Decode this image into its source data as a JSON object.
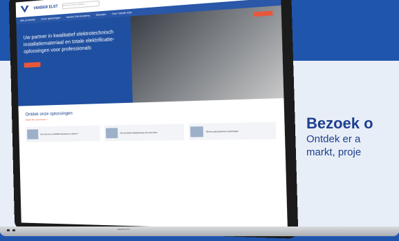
{
  "page": {
    "heading": "Bezoek o",
    "subtitle_line1": "Ontdek er a",
    "subtitle_line2": "markt, proje"
  },
  "laptop": {
    "base_label": "MacBook Pro",
    "site": {
      "brand": "VANDER ELST",
      "search_placeholder": "Zoek op merk, artikelnr, ...",
      "nav_items": [
        "Alle producten",
        "Onze oplossingen",
        "Vander Elst Academy",
        "Diensten",
        "Over Vander Elst"
      ],
      "header_button": "Contacteer ons",
      "hero_title": "Uw partner in kwalitatief elektrotechnisch installatiemateriaal en totale elektrificatie-oplossingen voor professionals",
      "hero_cta": "Contacteer ons",
      "section_title": "Ontdek onze oplossingen",
      "section_link": "Bekijk alle oplossingen >",
      "cards": [
        "Geen tijd om je installatiemateriaal op te pikken?",
        "Vind de ideale laadoplossing voor jouw klant",
        "Slimme gebouwbeheer oplossingen"
      ]
    }
  },
  "colors": {
    "brand_blue": "#1f55ad",
    "accent_orange": "#e8573b",
    "heading_blue": "#1d3f8f"
  }
}
